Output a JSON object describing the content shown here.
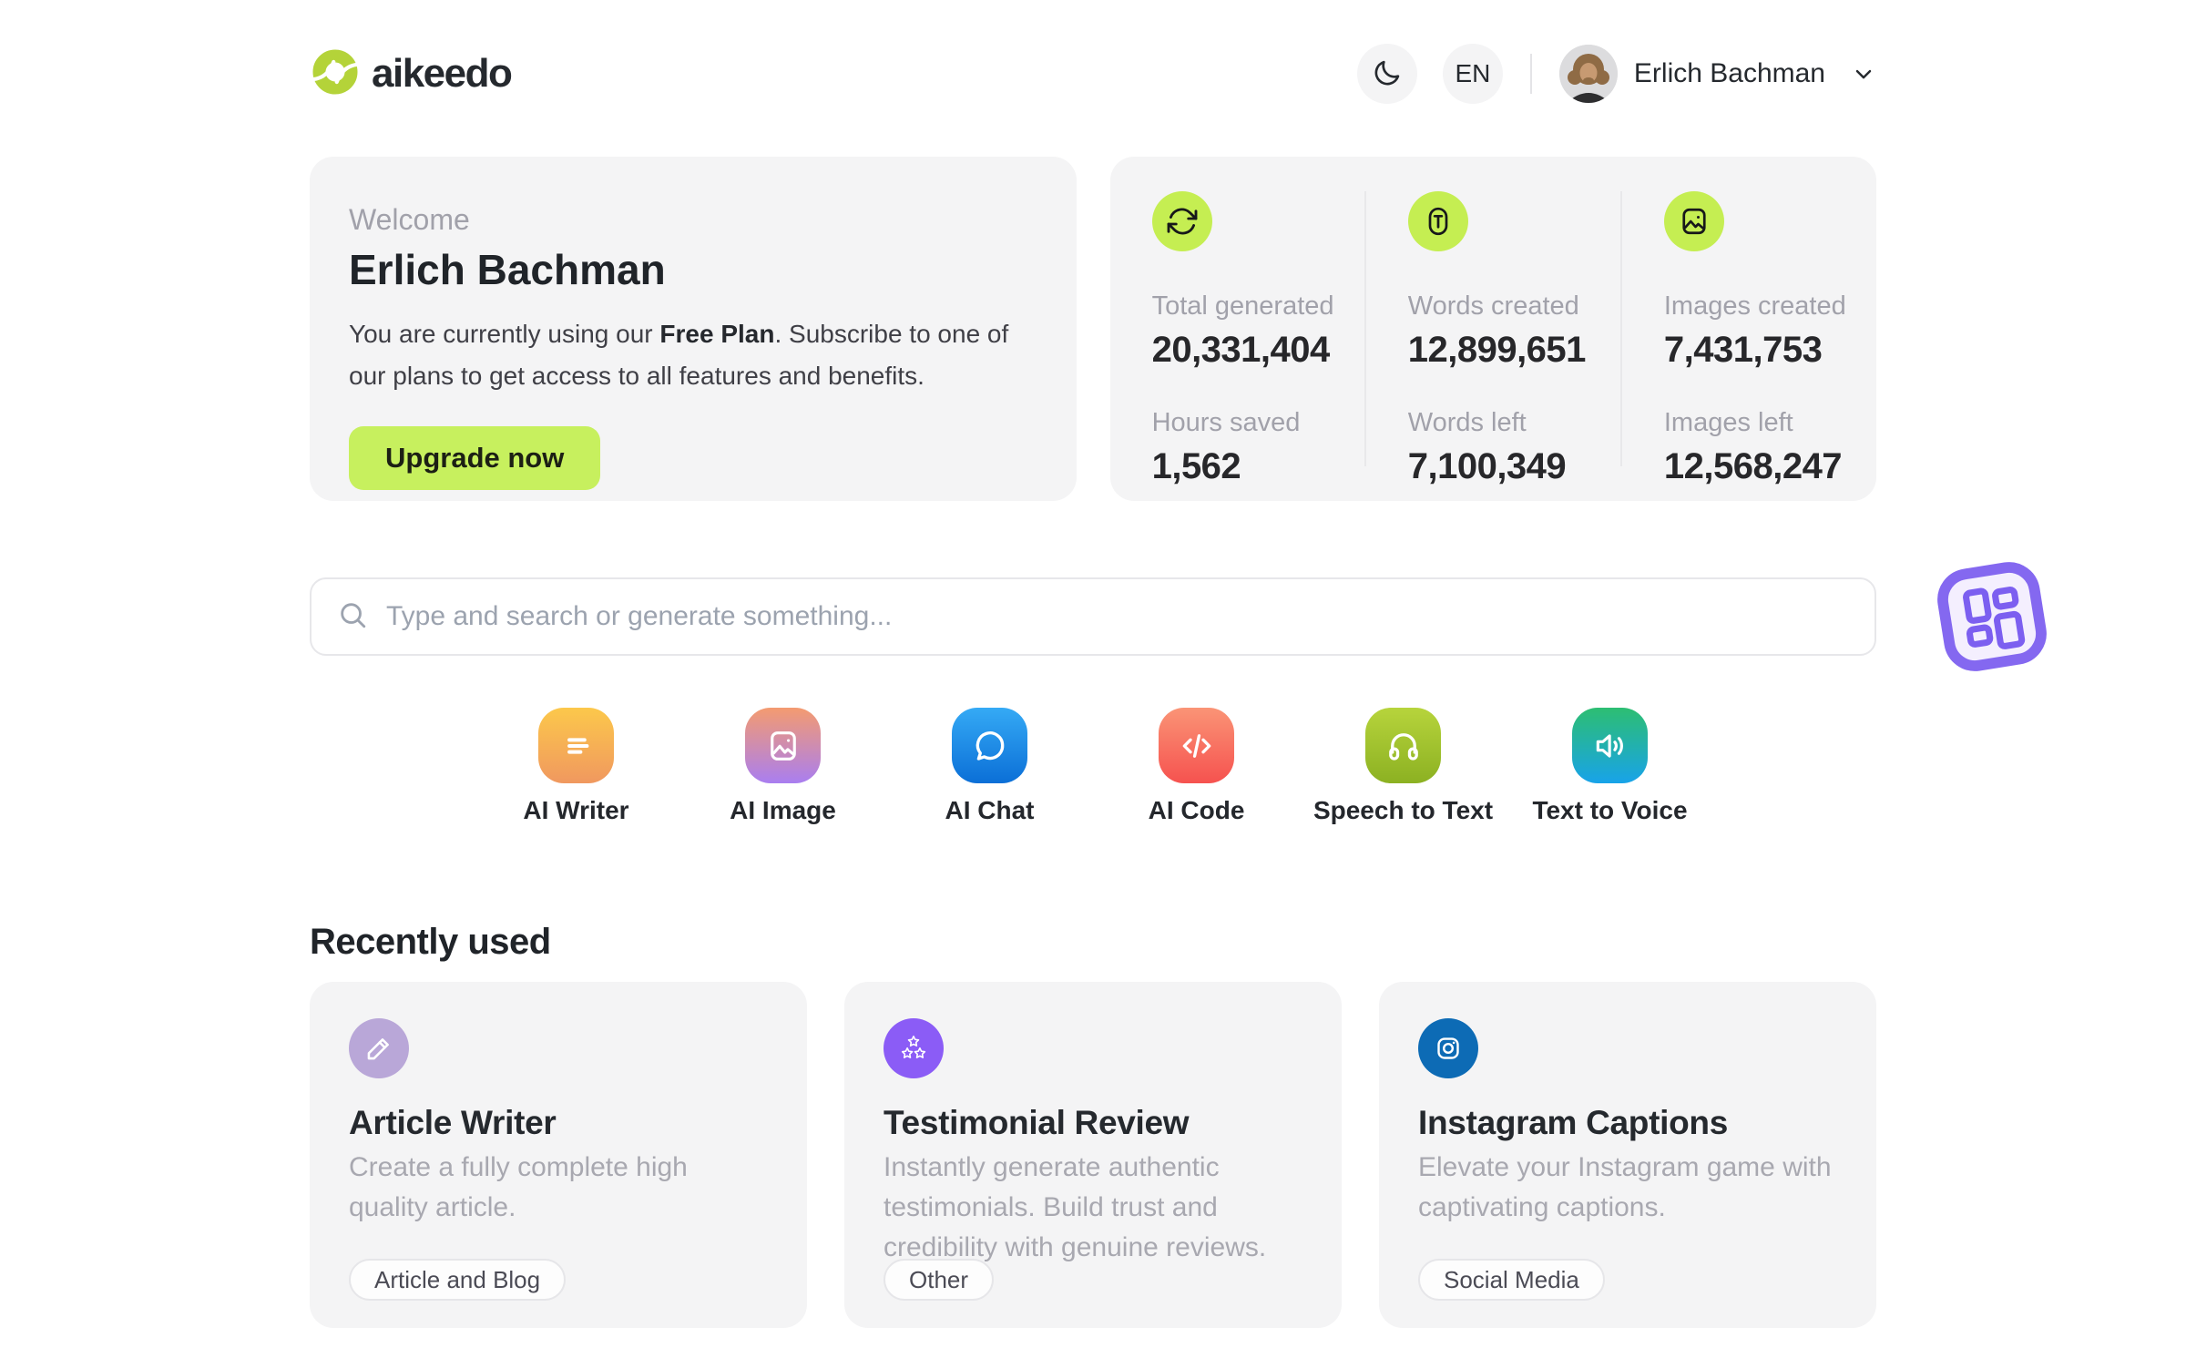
{
  "header": {
    "logo_text": "aikeedo",
    "language": "EN",
    "user_name": "Erlich Bachman"
  },
  "welcome": {
    "eyebrow": "Welcome",
    "name": "Erlich Bachman",
    "plan_text_pre": "You are currently using our ",
    "plan_name": "Free Plan",
    "plan_text_post": ". Subscribe to one of our plans to get access to all features and benefits.",
    "cta_label": "Upgrade now"
  },
  "stats": {
    "columns": [
      {
        "icon": "refresh-icon",
        "top": {
          "label": "Total generated",
          "value": "20,331,404"
        },
        "bottom": {
          "label": "Hours saved",
          "value": "1,562"
        }
      },
      {
        "icon": "text-icon",
        "top": {
          "label": "Words created",
          "value": "12,899,651"
        },
        "bottom": {
          "label": "Words left",
          "value": "7,100,349"
        }
      },
      {
        "icon": "image-icon",
        "top": {
          "label": "Images created",
          "value": "7,431,753"
        },
        "bottom": {
          "label": "Images left",
          "value": "12,568,247"
        }
      }
    ]
  },
  "search": {
    "placeholder": "Type and search or generate something..."
  },
  "tools": [
    {
      "label": "AI Writer",
      "icon": "writer-lines-icon",
      "gradient": [
        "#fcc84b",
        "#f0985f"
      ]
    },
    {
      "label": "AI Image",
      "icon": "image-icon",
      "gradient": [
        "#f49b70",
        "#a97ef0"
      ]
    },
    {
      "label": "AI Chat",
      "icon": "chat-bubble-icon",
      "gradient": [
        "#35aaf5",
        "#0b6fd7"
      ]
    },
    {
      "label": "AI Code",
      "icon": "code-icon",
      "gradient": [
        "#fa9476",
        "#f6524f"
      ]
    },
    {
      "label": "Speech to Text",
      "icon": "headphones-icon",
      "gradient": [
        "#b7d43c",
        "#8cb122"
      ]
    },
    {
      "label": "Text to Voice",
      "icon": "speaker-icon",
      "gradient": [
        "#2dbe72",
        "#18a3e9"
      ]
    }
  ],
  "recently_used": {
    "heading": "Recently used",
    "cards": [
      {
        "title": "Article Writer",
        "description": "Create a fully complete high quality article.",
        "tag": "Article and Blog",
        "icon": "pencil-icon",
        "icon_bg": "#b9a7d8"
      },
      {
        "title": "Testimonial Review",
        "description": "Instantly generate authentic testimonials. Build trust and credibility with genuine reviews.",
        "tag": "Other",
        "icon": "stars-icon",
        "icon_bg": "#8b5cf6"
      },
      {
        "title": "Instagram Captions",
        "description": "Elevate your Instagram game with captivating captions.",
        "tag": "Social Media",
        "icon": "instagram-icon",
        "icon_bg": "#0d6bb5"
      }
    ]
  },
  "colors": {
    "accent_lime": "#c7f05e",
    "stat_bubble_lime": "#c5ee52",
    "logo_green": "#b4d339",
    "card_background": "#f4f4f5",
    "muted_text": "#a1a1aa",
    "dark_text": "#25292e",
    "border": "#e4e4e7",
    "floating_badge_purple": "#8468f0"
  }
}
